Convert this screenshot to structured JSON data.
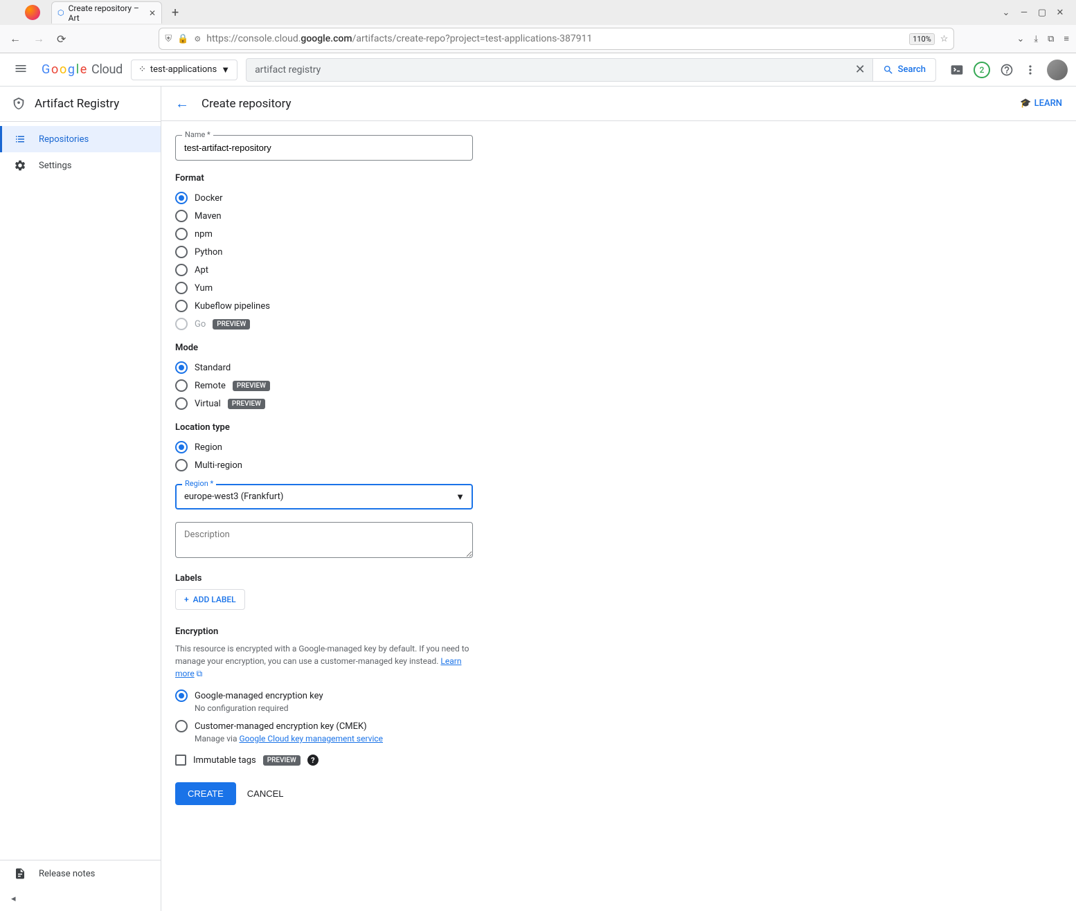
{
  "browser": {
    "tab_title": "Create repository – Art",
    "url_prefix": "https://console.cloud.",
    "url_bold": "google.com",
    "url_suffix": "/artifacts/create-repo?project=test-applications-387911",
    "zoom": "110%"
  },
  "header": {
    "logo_cloud": "Cloud",
    "project": "test-applications",
    "search_value": "artifact registry",
    "search_button": "Search",
    "trial_count": "2"
  },
  "sidebar": {
    "product_title": "Artifact Registry",
    "items": [
      {
        "label": "Repositories",
        "active": true
      },
      {
        "label": "Settings",
        "active": false
      }
    ],
    "release_notes": "Release notes"
  },
  "page": {
    "title": "Create repository",
    "learn": "LEARN"
  },
  "form": {
    "name_label": "Name *",
    "name_value": "test-artifact-repository",
    "format_heading": "Format",
    "formats": [
      {
        "label": "Docker",
        "checked": true
      },
      {
        "label": "Maven"
      },
      {
        "label": "npm"
      },
      {
        "label": "Python"
      },
      {
        "label": "Apt"
      },
      {
        "label": "Yum"
      },
      {
        "label": "Kubeflow pipelines"
      },
      {
        "label": "Go",
        "preview": true,
        "disabled": true
      }
    ],
    "mode_heading": "Mode",
    "modes": [
      {
        "label": "Standard",
        "checked": true
      },
      {
        "label": "Remote",
        "preview": true
      },
      {
        "label": "Virtual",
        "preview": true
      }
    ],
    "location_type_heading": "Location type",
    "location_types": [
      {
        "label": "Region",
        "checked": true
      },
      {
        "label": "Multi-region"
      }
    ],
    "region_label": "Region *",
    "region_value": "europe-west3 (Frankfurt)",
    "description_placeholder": "Description",
    "labels_heading": "Labels",
    "add_label": "ADD LABEL",
    "encryption_heading": "Encryption",
    "encryption_desc": "This resource is encrypted with a Google-managed key by default. If you need to manage your encryption, you can use a customer-managed key instead. ",
    "learn_more": "Learn more",
    "encryption_options": [
      {
        "label": "Google-managed encryption key",
        "sub": "No configuration required",
        "checked": true
      },
      {
        "label": "Customer-managed encryption key (CMEK)",
        "sub_prefix": "Manage via ",
        "sub_link": "Google Cloud key management service"
      }
    ],
    "immutable_label": "Immutable tags",
    "preview_badge": "PREVIEW",
    "create_btn": "CREATE",
    "cancel_btn": "CANCEL"
  }
}
